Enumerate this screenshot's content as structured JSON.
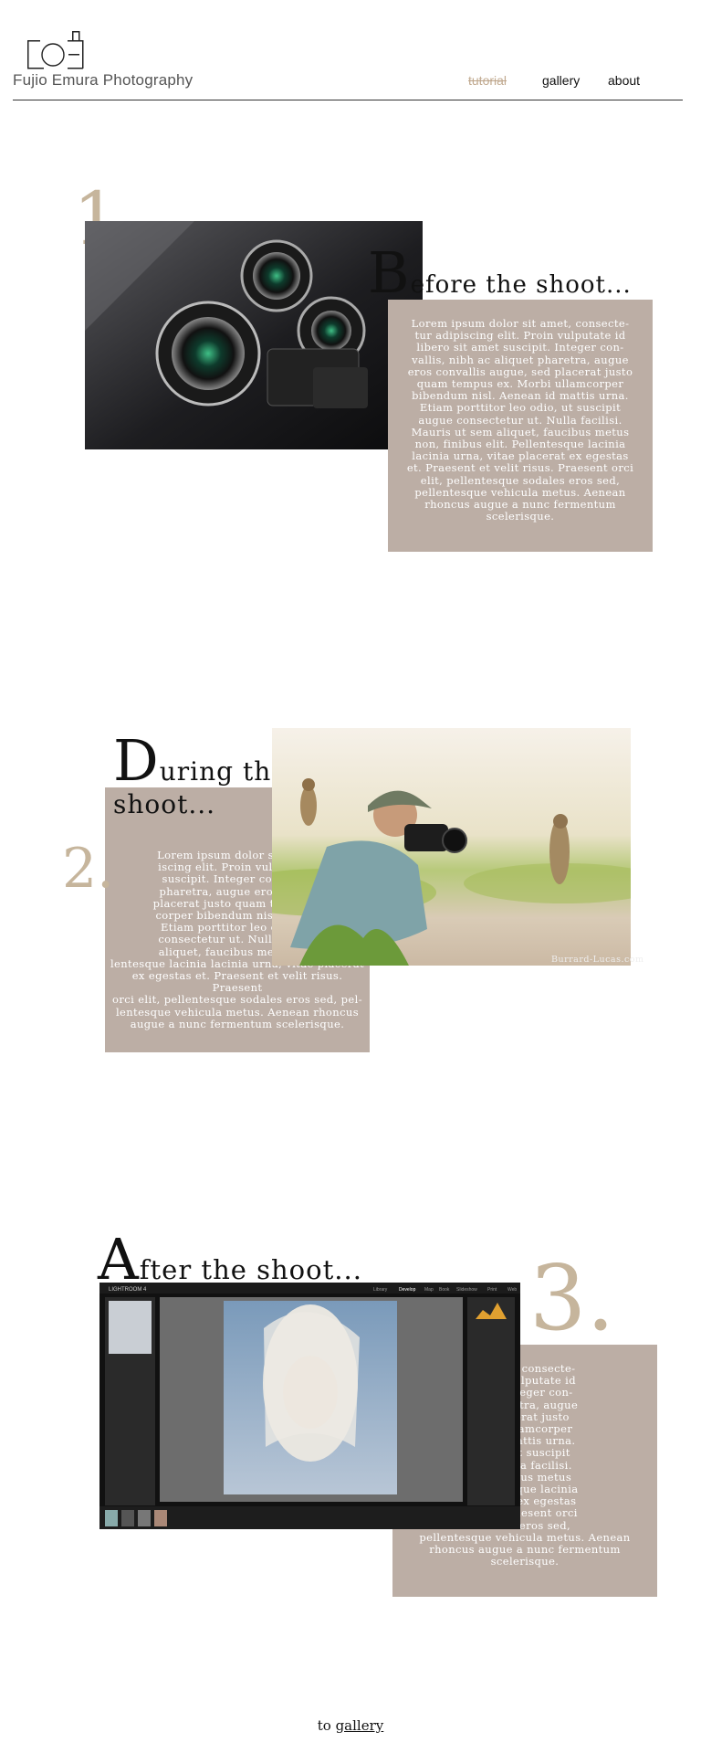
{
  "header": {
    "brand": "Fujio Emura Photography",
    "nav": {
      "tutorial": "tutorial",
      "gallery": "gallery",
      "about": "about"
    }
  },
  "sections": [
    {
      "number": "1.",
      "heading_cap": "B",
      "heading_rest": "efore the shoot...",
      "body": "Lorem ipsum dolor sit amet, consecte-\ntur adipiscing elit. Proin vulputate id\nlibero sit amet suscipit. Integer con-\nvallis, nibh ac aliquet pharetra, augue\neros convallis augue, sed placerat justo\nquam tempus ex. Morbi ullamcorper\nbibendum nisl. Aenean id mattis urna.\nEtiam porttitor leo odio, ut suscipit\naugue consectetur ut. Nulla facilisi.\nMauris ut sem aliquet, faucibus metus\nnon, finibus elit. Pellentesque lacinia\nlacinia urna, vitae placerat ex egestas\net. Praesent et velit risus. Praesent orci\nelit, pellentesque sodales eros sed,\npellentesque vehicula metus. Aenean\nrhoncus augue a nunc fermentum\nscelerisque."
    },
    {
      "number": "2.",
      "heading_cap": "D",
      "heading_rest": "uring the",
      "heading_line2": "shoot...",
      "body": "Lorem ipsum dolor sit amet,\niscing elit. Proin vulputate i\nsuscipit. Integer convallis,\npharetra, augue eros conva\nplacerat justo quam tempus e\ncorper bibendum nisl. Aenea\nEtiam porttitor leo odio, ut\nconsectetur ut. Nulla facilis\naliquet, faucibus metus non\nlentesque lacinia lacinia urna, vitae placerat\nex egestas et. Praesent et velit risus. Praesent\norci elit, pellentesque sodales eros sed, pel-\nlentesque vehicula metus. Aenean rhoncus\naugue a nunc fermentum scelerisque.",
      "photo_credit": "Burrard-Lucas.com"
    },
    {
      "number": "3.",
      "heading_cap": "A",
      "heading_rest": "fter the shoot...",
      "body": "it amet, consecte-\nProin vulputate id\nipit. Integer con-\net pharetra, augue\nd placerat justo\norbi ullamcorper\nan id mattis urna.\nodio, ut suscipit\nat. Nulla facilisi.\n, faucibus metus\nellentesque lacinia\nlacerat ex egestas\nisus. Praesent orci\nodales eros sed,\npellentesque vehicula metus. Aenean\nrhoncus augue a nunc fermentum\nscelerisque.",
      "app_title": "LIGHTROOM 4",
      "app_modules": [
        "Library",
        "Develop",
        "Map",
        "Book",
        "Slideshow",
        "Print",
        "Web"
      ]
    }
  ],
  "footer": {
    "prefix": "to",
    "link": "gallery"
  },
  "colors": {
    "accent_number": "#c6b59c",
    "box": "#bcaea5",
    "nav_active": "#c2ab91"
  }
}
